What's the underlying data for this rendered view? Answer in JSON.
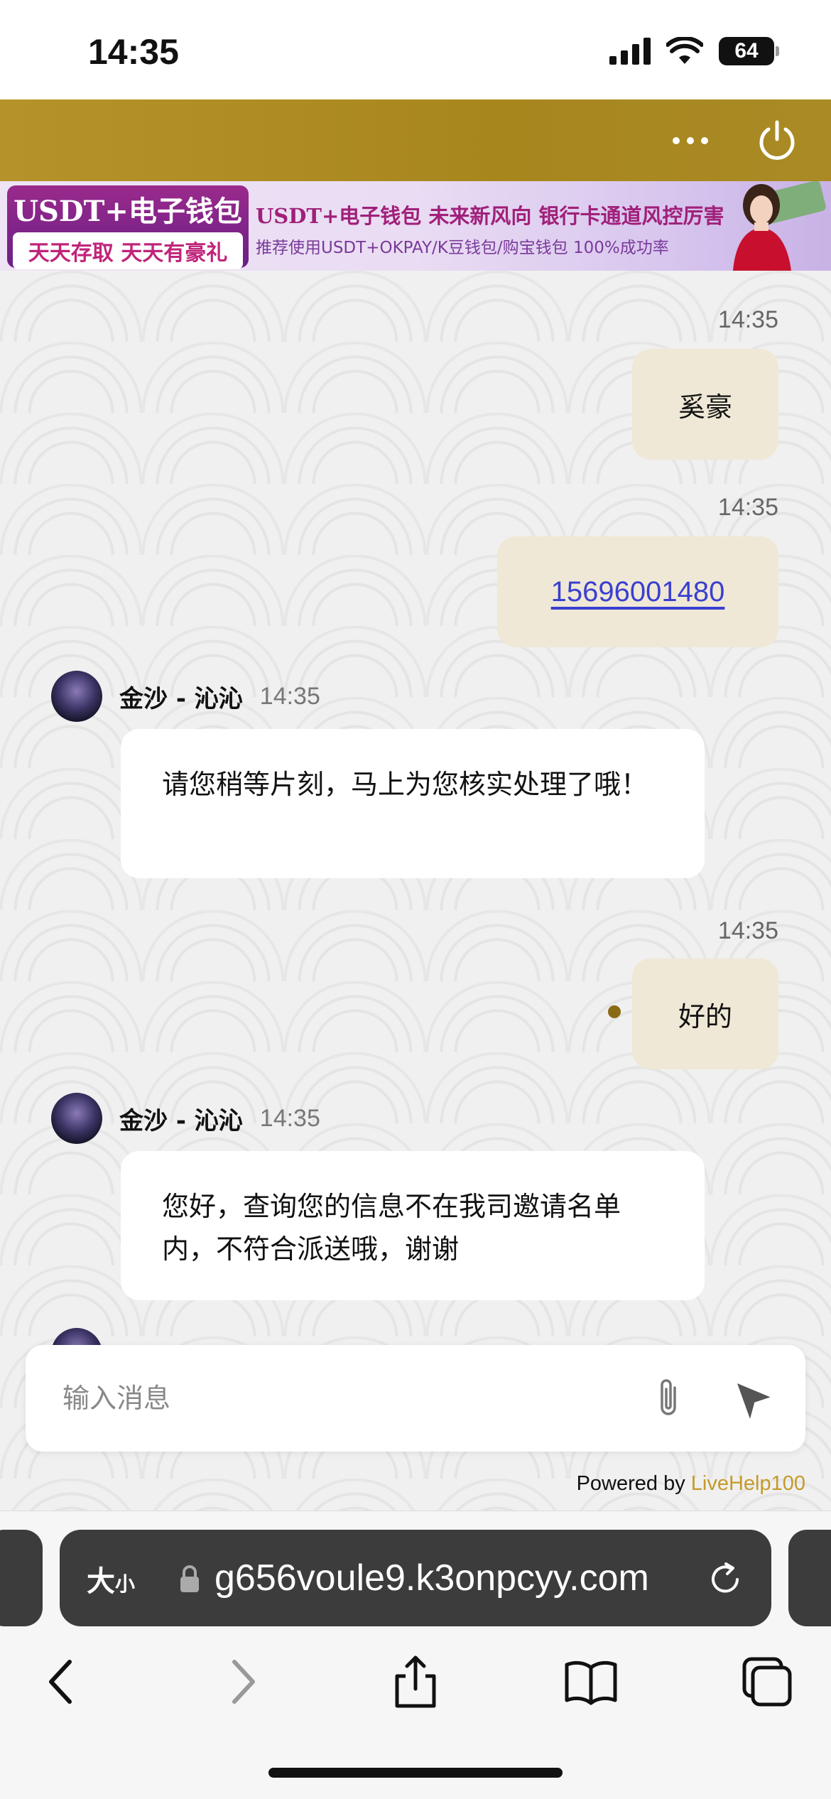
{
  "status_bar": {
    "time": "14:35",
    "battery": "64"
  },
  "banner": {
    "left_title": "USDT+电子钱包",
    "left_subtitle": "天天存取 天天有豪礼",
    "mid_title": "USDT+电子钱包  未来新风向  银行卡通道风控厉害",
    "mid_subtitle": "推荐使用USDT+OKPAY/K豆钱包/购宝钱包  100%成功率"
  },
  "messages": [
    {
      "direction": "out",
      "time": "14:35",
      "text": "奚豪"
    },
    {
      "direction": "out",
      "time": "14:35",
      "text": "15696001480"
    },
    {
      "direction": "in",
      "agent": "金沙 - 沁沁",
      "time": "14:35",
      "text": "请您稍等片刻，马上为您核实处理了哦！"
    },
    {
      "direction": "out",
      "time": "14:35",
      "text": "好的"
    },
    {
      "direction": "in",
      "agent": "金沙 - 沁沁",
      "time": "14:35",
      "text": "您好，查询您的信息不在我司邀请名单内，不符合派送哦，谢谢"
    }
  ],
  "input": {
    "placeholder": "输入消息"
  },
  "footer": {
    "powered_prefix": "Powered by ",
    "brand": "LiveHelp100"
  },
  "browser": {
    "size_label": "大",
    "size_label_small": "小",
    "url": "g656voule9.k3onpcyy.com"
  },
  "colors": {
    "header_gold": "#a8861e",
    "bubble_out": "#efe8d6",
    "link": "#3a3fd0",
    "brand": "#c49a2a"
  }
}
